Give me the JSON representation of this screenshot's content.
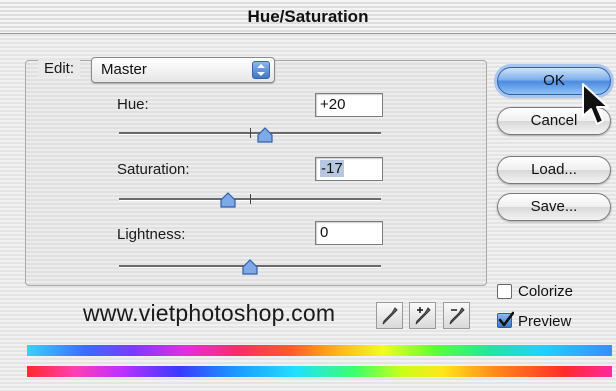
{
  "window": {
    "title": "Hue/Saturation"
  },
  "edit": {
    "label": "Edit:",
    "selected": "Master"
  },
  "hue": {
    "label": "Hue:",
    "value": "+20",
    "level": 20,
    "min": -180,
    "max": 180
  },
  "saturation": {
    "label": "Saturation:",
    "value": "-17",
    "level": -17,
    "min": -100,
    "max": 100
  },
  "lightness": {
    "label": "Lightness:",
    "value": "0",
    "level": 0,
    "min": -100,
    "max": 100
  },
  "buttons": {
    "ok": "OK",
    "cancel": "Cancel",
    "load": "Load...",
    "save": "Save..."
  },
  "options": {
    "colorize": {
      "label": "Colorize",
      "checked": false
    },
    "preview": {
      "label": "Preview",
      "checked": true
    }
  },
  "watermark": "www.vietphotoshop.com",
  "icons": [
    "eyedropper-icon",
    "eyedropper-plus-icon",
    "eyedropper-minus-icon",
    "pointer-cursor-icon",
    "checkmark-icon",
    "select-arrows-icon"
  ]
}
